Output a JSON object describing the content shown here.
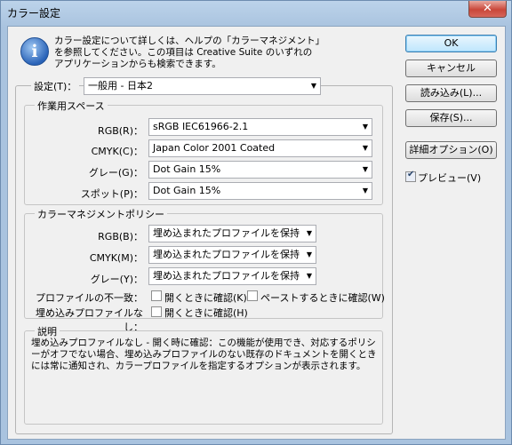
{
  "window": {
    "title": "カラー設定",
    "close_label": "✕"
  },
  "info": {
    "icon": "info-icon",
    "text": "カラー設定について詳しくは、ヘルプの「カラーマネジメント」を参照してください。この項目は Creative Suite のいずれのアプリケーションからも検索できます。"
  },
  "buttons": {
    "ok": "OK",
    "cancel": "キャンセル",
    "load": "読み込み(L)...",
    "save": "保存(S)...",
    "advanced": "詳細オプション(O)"
  },
  "preview": {
    "label": "プレビュー(V)",
    "checked": true
  },
  "settings": {
    "label": "設定(T)：",
    "value": "一般用 - 日本2"
  },
  "working_spaces": {
    "legend": "作業用スペース",
    "rgb": {
      "label": "RGB(R)：",
      "value": "sRGB IEC61966-2.1"
    },
    "cmyk": {
      "label": "CMYK(C)：",
      "value": "Japan Color 2001 Coated"
    },
    "gray": {
      "label": "グレー(G)：",
      "value": "Dot Gain 15%"
    },
    "spot": {
      "label": "スポット(P)：",
      "value": "Dot Gain 15%"
    }
  },
  "policies": {
    "legend": "カラーマネジメントポリシー",
    "rgb": {
      "label": "RGB(B)：",
      "value": "埋め込まれたプロファイルを保持"
    },
    "cmyk": {
      "label": "CMYK(M)：",
      "value": "埋め込まれたプロファイルを保持"
    },
    "gray": {
      "label": "グレー(Y)：",
      "value": "埋め込まれたプロファイルを保持"
    },
    "mismatch": {
      "label": "プロファイルの不一致：",
      "ask_open": "開くときに確認(K)",
      "ask_paste": "ペーストするときに確認(W)"
    },
    "missing": {
      "label": "埋め込みプロファイルなし：",
      "ask_open": "開くときに確認(H)"
    }
  },
  "description": {
    "legend": "説明",
    "text": "埋め込みプロファイルなし - 開く時に確認：この機能が使用でき、対応するポリシーがオフでない場合、埋め込みプロファイルのない既存のドキュメントを開くときには常に通知され、カラープロファイルを指定するオプションが表示されます。"
  }
}
